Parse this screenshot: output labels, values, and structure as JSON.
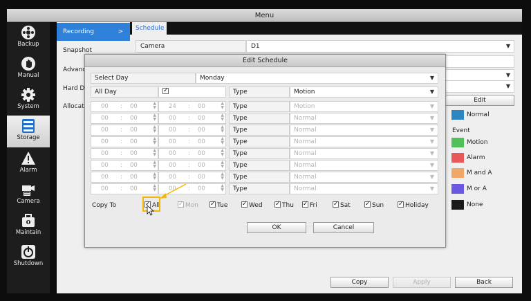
{
  "window": {
    "title": "Menu"
  },
  "nav": [
    {
      "label": "Backup",
      "icon": "backup-icon"
    },
    {
      "label": "Manual",
      "icon": "hand-icon"
    },
    {
      "label": "System",
      "icon": "gear-icon"
    },
    {
      "label": "Storage",
      "icon": "storage-icon",
      "active": true
    },
    {
      "label": "Alarm",
      "icon": "warning-icon"
    },
    {
      "label": "Camera",
      "icon": "camera-icon"
    },
    {
      "label": "Maintain",
      "icon": "toolbox-icon"
    },
    {
      "label": "Shutdown",
      "icon": "power-icon"
    }
  ],
  "subnav": [
    {
      "label": "Recording",
      "active": true,
      "chevron": ">"
    },
    {
      "label": "Snapshot"
    },
    {
      "label": "Advanc"
    },
    {
      "label": "Hard D"
    },
    {
      "label": "Allocate"
    }
  ],
  "tabs": [
    {
      "label": "Schedule"
    }
  ],
  "main": {
    "camera_label": "Camera",
    "camera_value": "D1",
    "edit_button": "Edit",
    "event_label": "Event",
    "legend": [
      {
        "label": "Normal",
        "color": "#2e86c1"
      },
      {
        "label": "Motion",
        "color": "#52c05a"
      },
      {
        "label": "Alarm",
        "color": "#e8585a"
      },
      {
        "label": "M and A",
        "color": "#f0a868"
      },
      {
        "label": "M or A",
        "color": "#6a58e0"
      },
      {
        "label": "None",
        "color": "#1a1a1a"
      }
    ],
    "buttons": {
      "copy": "Copy",
      "apply": "Apply",
      "back": "Back"
    }
  },
  "dialog": {
    "title": "Edit Schedule",
    "select_day_label": "Select Day",
    "select_day_value": "Monday",
    "all_day_label": "All Day",
    "type_label": "Type",
    "type_value": "Motion",
    "periods": [
      {
        "start_h": "00",
        "start_m": "00",
        "end_h": "24",
        "end_m": "00",
        "type": "Motion"
      },
      {
        "start_h": "00",
        "start_m": "00",
        "end_h": "00",
        "end_m": "00",
        "type": "Normal"
      },
      {
        "start_h": "00",
        "start_m": "00",
        "end_h": "00",
        "end_m": "00",
        "type": "Normal"
      },
      {
        "start_h": "00",
        "start_m": "00",
        "end_h": "00",
        "end_m": "00",
        "type": "Normal"
      },
      {
        "start_h": "00",
        "start_m": "00",
        "end_h": "00",
        "end_m": "00",
        "type": "Normal"
      },
      {
        "start_h": "00",
        "start_m": "00",
        "end_h": "00",
        "end_m": "00",
        "type": "Normal"
      },
      {
        "start_h": "00",
        "start_m": "00",
        "end_h": "00",
        "end_m": "00",
        "type": "Normal"
      },
      {
        "start_h": "00",
        "start_m": "00",
        "end_h": "00",
        "end_m": "00",
        "type": "Normal"
      }
    ],
    "time_sep": ":",
    "copy_to_label": "Copy To",
    "copy_days": [
      {
        "label": "All",
        "checked": true
      },
      {
        "label": "Mon",
        "checked": true,
        "disabled": true
      },
      {
        "label": "Tue",
        "checked": true
      },
      {
        "label": "Wed",
        "checked": true
      },
      {
        "label": "Thu",
        "checked": true
      },
      {
        "label": "Fri",
        "checked": true
      },
      {
        "label": "Sat",
        "checked": true
      },
      {
        "label": "Sun",
        "checked": true
      },
      {
        "label": "Holiday",
        "checked": true
      }
    ],
    "ok": "OK",
    "cancel": "Cancel"
  },
  "accent_color": "#2f80d8",
  "highlight_color": "#f5b800"
}
